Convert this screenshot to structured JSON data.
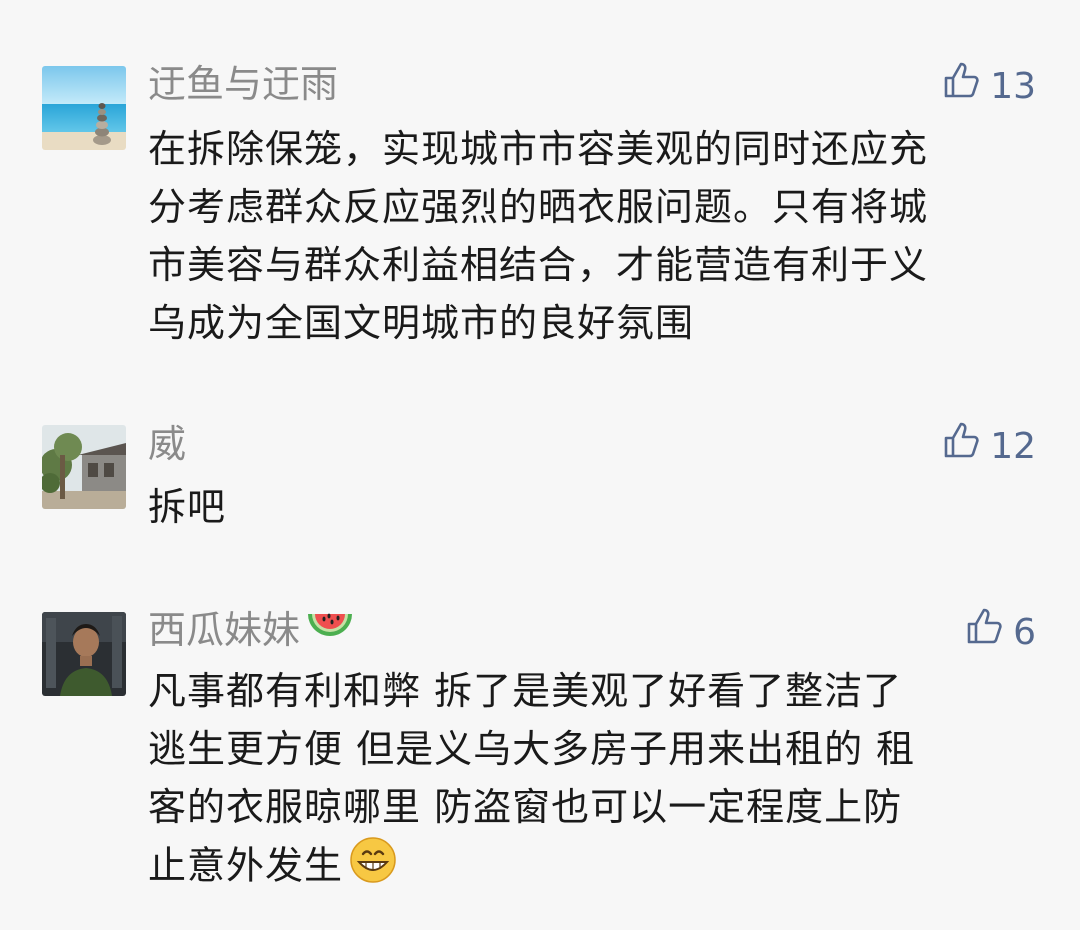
{
  "comments": [
    {
      "author": "迂鱼与迂雨",
      "likes": "13",
      "avatar": "avatar-beach-stones",
      "lines": [
        "在拆除保笼，实现城市市容美观的同时还应充",
        "分考虑群众反应强烈的晒衣服问题。只有将城",
        "市美容与群众利益相结合，才能营造有利于义",
        "乌成为全国文明城市的良好氛围"
      ]
    },
    {
      "author": "威",
      "likes": "12",
      "avatar": "avatar-tree-building",
      "lines": [
        "拆吧"
      ]
    },
    {
      "author": "西瓜妹妹",
      "author_emoji": "watermelon-icon",
      "likes": "6",
      "avatar": "avatar-person-photo",
      "lines": [
        "凡事都有利和弊 拆了是美观了好看了整洁了",
        "逃生更方便 但是义乌大多房子用来出租的 租",
        "客的衣服晾哪里 防盗窗也可以一定程度上防",
        "止意外发生"
      ],
      "trailing_emoji": "grinning-face-icon"
    }
  ],
  "colors": {
    "background": "#f7f7f7",
    "author": "#8a8a8a",
    "like": "#55698f",
    "text": "#1a1a1a"
  }
}
